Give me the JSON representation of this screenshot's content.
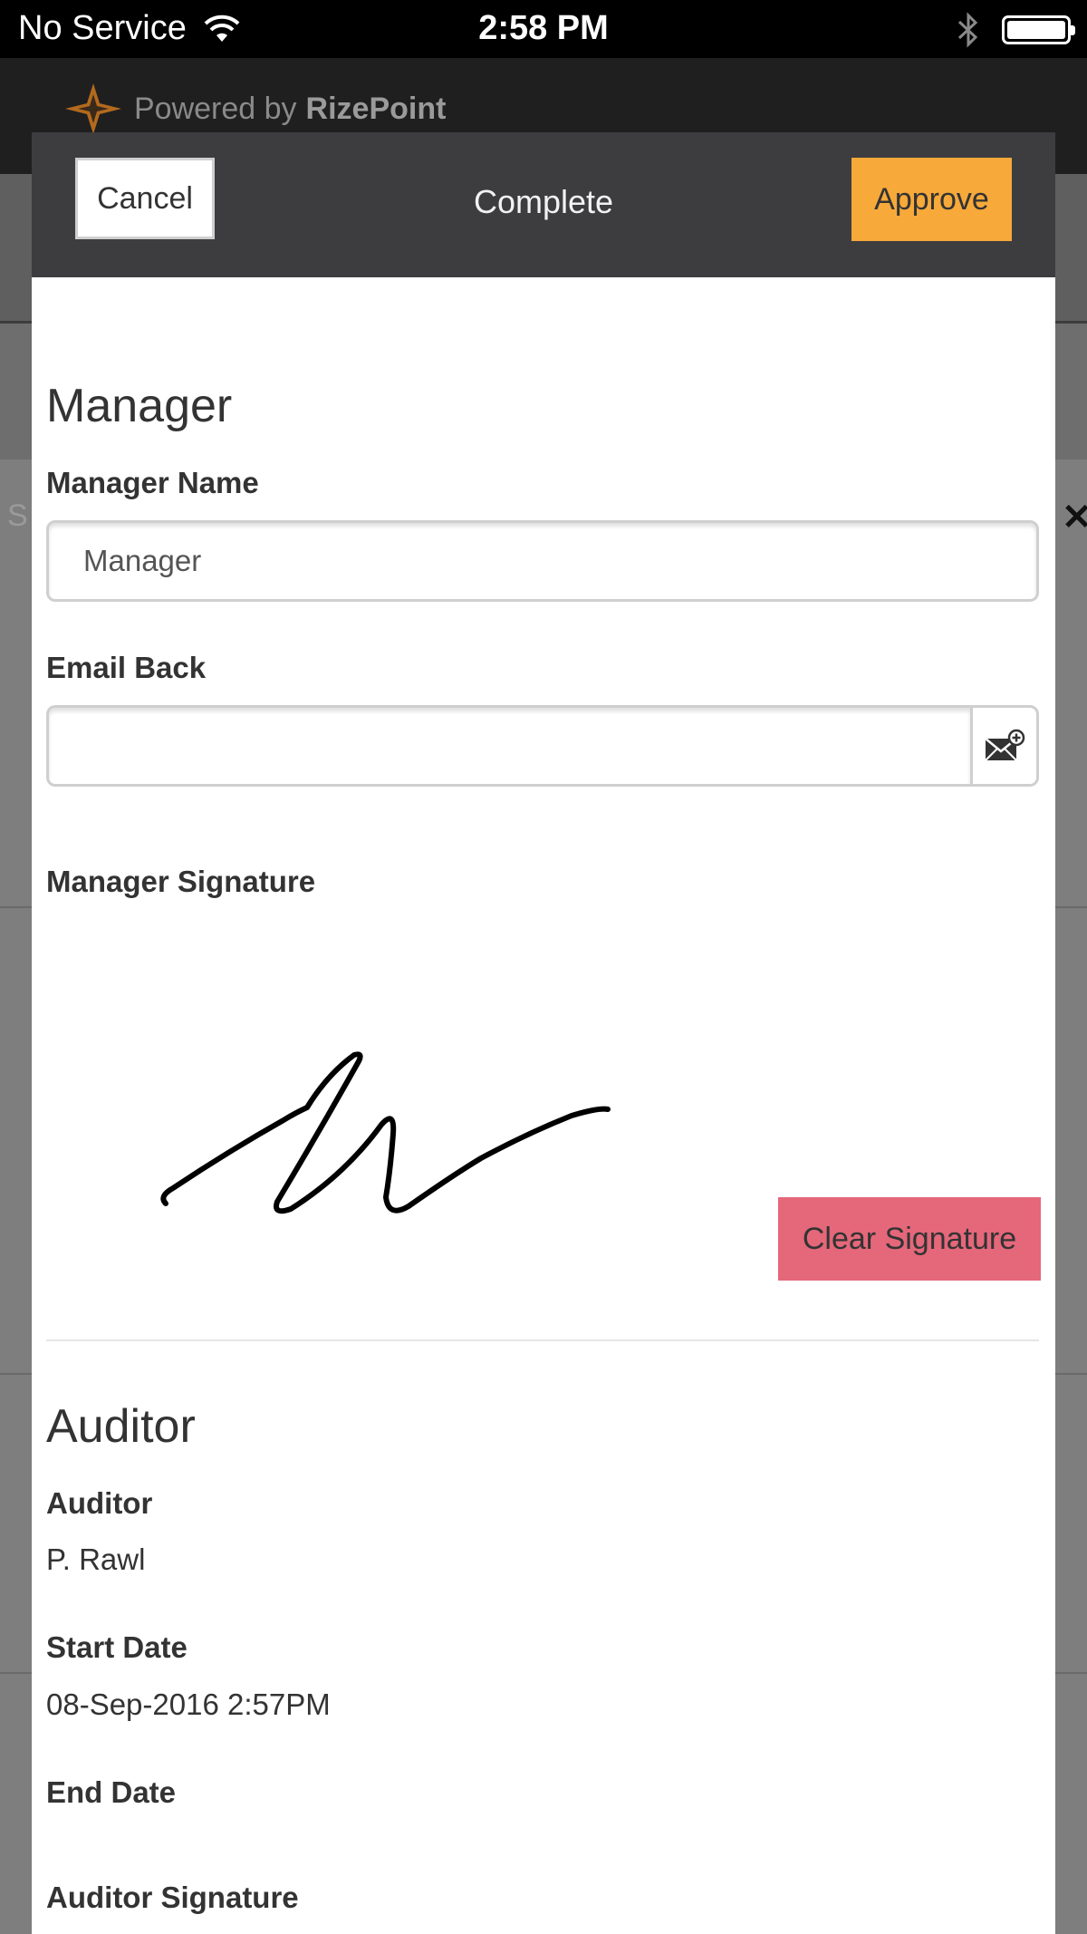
{
  "status_bar": {
    "carrier": "No Service",
    "time": "2:58 PM"
  },
  "app": {
    "powered_by": "Powered by",
    "brand": "RizePoint",
    "bg_search_letter": "S",
    "bg_close_glyph": "✕"
  },
  "modal": {
    "cancel_label": "Cancel",
    "title": "Complete",
    "approve_label": "Approve"
  },
  "manager": {
    "section_title": "Manager",
    "name_label": "Manager Name",
    "name_value": "Manager",
    "email_label": "Email Back",
    "email_value": "",
    "signature_label": "Manager Signature",
    "clear_label": "Clear Signature"
  },
  "auditor": {
    "section_title": "Auditor",
    "auditor_label": "Auditor",
    "auditor_value": "P. Rawl",
    "start_label": "Start Date",
    "start_value": "08-Sep-2016 2:57PM",
    "end_label": "End Date",
    "end_value": "",
    "signature_label": "Auditor Signature"
  },
  "icons": {
    "wifi": "wifi-icon",
    "bluetooth": "bluetooth-icon",
    "battery": "battery-icon",
    "logo": "rizepoint-logo-icon",
    "email_add": "email-add-icon",
    "close": "close-icon"
  },
  "colors": {
    "approve": "#f7a93a",
    "clear_signature": "#e5677a",
    "modal_header": "#3d3d3f"
  }
}
